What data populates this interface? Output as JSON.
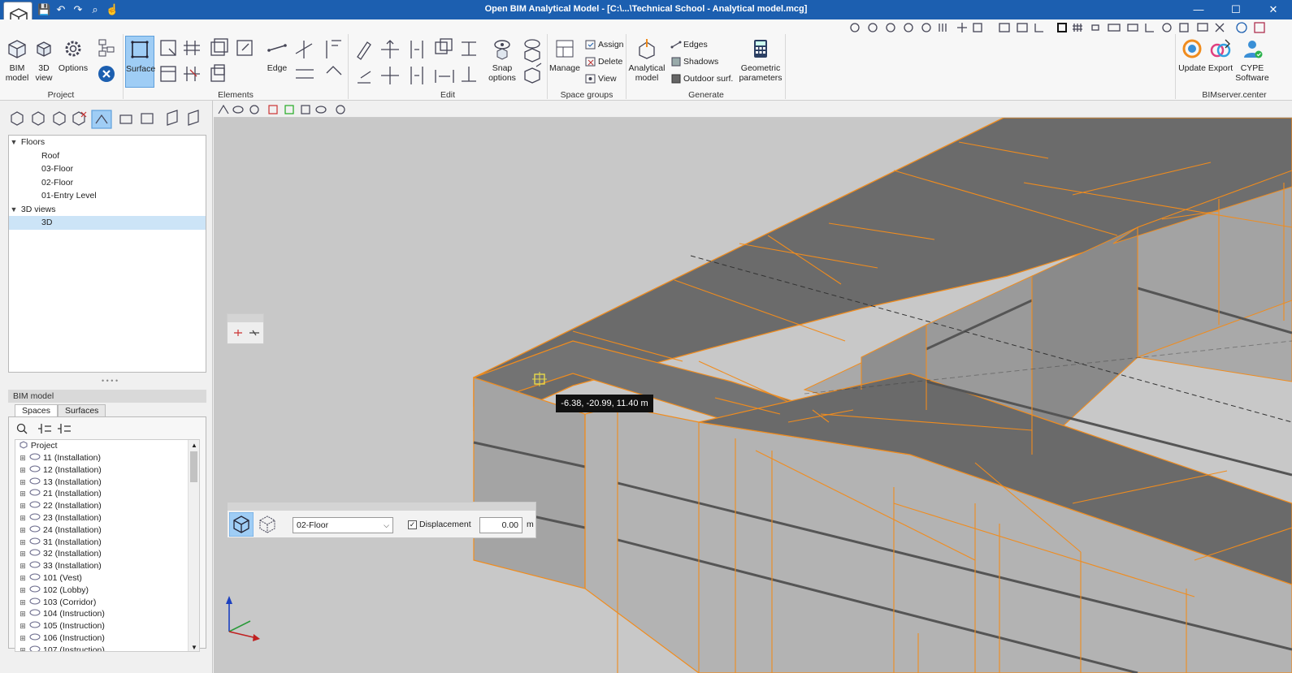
{
  "window": {
    "title": "Open BIM Analytical Model - [C:\\...\\Technical School - Analytical model.mcg]",
    "minimize": "—",
    "maximize": "☐",
    "close": "✕"
  },
  "ribbon": {
    "project": {
      "label": "Project",
      "bim_model": "BIM model",
      "view_3d": "3D view",
      "options": "Options"
    },
    "elements": {
      "label": "Elements",
      "surface": "Surface",
      "edge": "Edge"
    },
    "edit": {
      "label": "Edit",
      "snap_options": "Snap options"
    },
    "space_groups": {
      "label": "Space groups",
      "manage": "Manage",
      "assign": "Assign",
      "delete": "Delete",
      "view": "View"
    },
    "generate": {
      "label": "Generate",
      "analytical_model": "Analytical model",
      "edges": "Edges",
      "shadows": "Shadows",
      "outdoor_surf": "Outdoor surf.",
      "geometric_parameters": "Geometric parameters"
    },
    "bimserver": {
      "label": "BIMserver.center",
      "update": "Update",
      "export": "Export",
      "cype_software": "CYPE Software"
    }
  },
  "tree": {
    "floors_label": "Floors",
    "floors": [
      "Roof",
      "03-Floor",
      "02-Floor",
      "01-Entry Level"
    ],
    "views_label": "3D views",
    "views": [
      "3D"
    ]
  },
  "bim_panel": {
    "title": "BIM model",
    "tabs": [
      "Spaces",
      "Surfaces"
    ],
    "root": "Project",
    "spaces": [
      "11 (Installation)",
      "12 (Installation)",
      "13 (Installation)",
      "21 (Installation)",
      "22 (Installation)",
      "23 (Installation)",
      "24 (Installation)",
      "31 (Installation)",
      "32 (Installation)",
      "33 (Installation)",
      "101 (Vest)",
      "102 (Lobby)",
      "103 (Corridor)",
      "104 (Instruction)",
      "105 (Instruction)",
      "106 (Instruction)",
      "107 (Instruction)"
    ]
  },
  "viewport": {
    "coordinate_readout": "-6.38, -20.99, 11.40 m",
    "floor_selected": "02-Floor",
    "displacement_label": "Displacement",
    "displacement_checked": true,
    "displacement_value": "0.00",
    "displacement_unit": "m"
  },
  "colors": {
    "titlebar": "#1c5fb0",
    "edge_highlight": "#f08c1e",
    "active_tool": "#9fcdf5"
  }
}
